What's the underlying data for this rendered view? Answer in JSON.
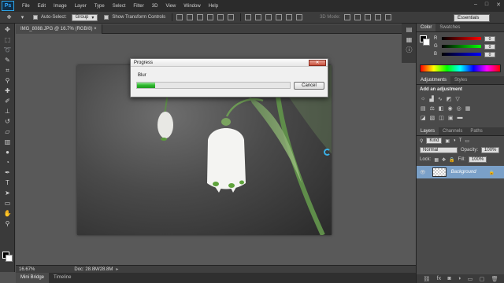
{
  "app": {
    "logo": "Ps"
  },
  "menu": [
    "File",
    "Edit",
    "Image",
    "Layer",
    "Type",
    "Select",
    "Filter",
    "3D",
    "View",
    "Window",
    "Help"
  ],
  "window_controls": [
    "–",
    "□",
    "✕"
  ],
  "options_bar": {
    "auto_select_label": "Auto-Select:",
    "auto_select_value": "Group",
    "transform_label": "Show Transform Controls",
    "mode_3d_label": "3D Mode:",
    "workspace": "Essentials"
  },
  "document": {
    "tab_label": "IMG_8088.JPG @ 16.7% (RGB/8)",
    "tab_close": "×",
    "zoom": "16.67%",
    "doc_size": "Doc: 28.8M/28.8M"
  },
  "bottom_tabs": [
    "Mini Bridge",
    "Timeline"
  ],
  "color_panel": {
    "tabs": [
      "Color",
      "Swatches"
    ],
    "sliders": [
      {
        "label": "R",
        "value": "0"
      },
      {
        "label": "G",
        "value": "0"
      },
      {
        "label": "B",
        "value": "0"
      }
    ]
  },
  "adjustments_panel": {
    "tabs": [
      "Adjustments",
      "Styles"
    ],
    "title": "Add an adjustment"
  },
  "layers_panel": {
    "tabs": [
      "Layers",
      "Channels",
      "Paths"
    ],
    "kind_label": "Kind",
    "blend_mode": "Normal",
    "opacity_label": "Opacity:",
    "opacity_value": "100%",
    "lock_label": "Lock:",
    "fill_label": "Fill:",
    "fill_value": "100%",
    "layers": [
      {
        "name": "Background"
      }
    ]
  },
  "progress_dialog": {
    "title": "Progress",
    "close": "✕",
    "operation": "Blur",
    "progress": 0.12,
    "cancel_label": "Cancel"
  },
  "colors": {
    "progress_fill": "#2eb82e",
    "selected_layer": "#7aa0c8",
    "photoshop_blue": "#31a8ff"
  }
}
